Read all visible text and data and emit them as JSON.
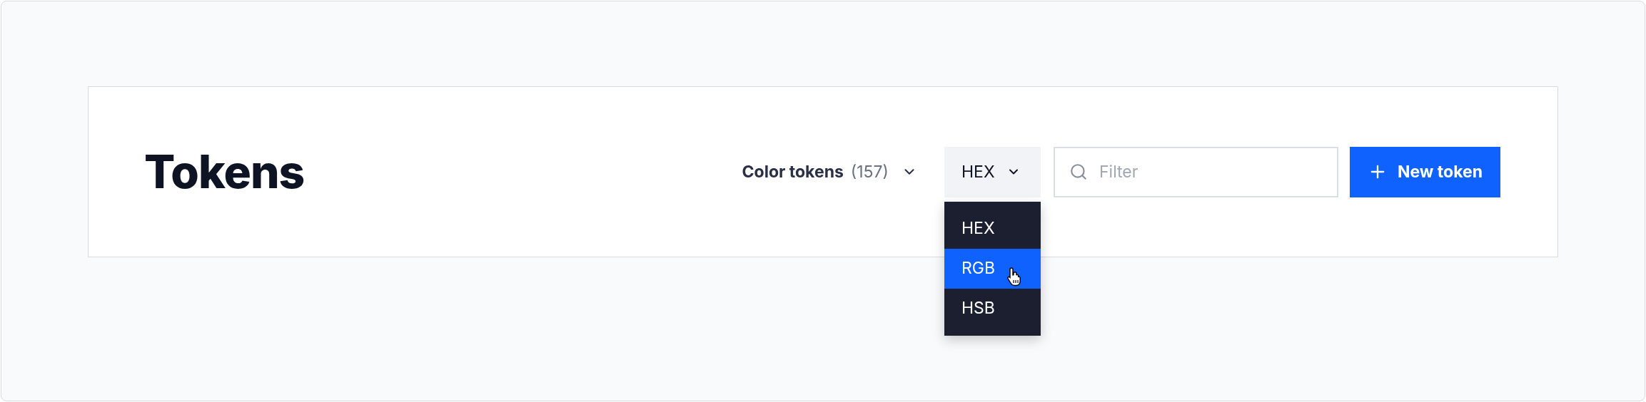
{
  "title": "Tokens",
  "token_filter": {
    "label": "Color tokens",
    "count": "(157)"
  },
  "format_select": {
    "value": "HEX",
    "expanded": true,
    "options": [
      {
        "label": "HEX",
        "highlighted": false
      },
      {
        "label": "RGB",
        "highlighted": true
      },
      {
        "label": "HSB",
        "highlighted": false
      }
    ]
  },
  "search": {
    "placeholder": "Filter"
  },
  "new_button": "New token"
}
